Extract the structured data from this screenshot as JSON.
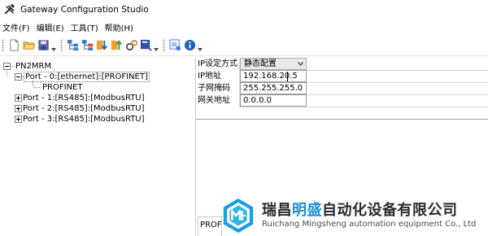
{
  "window": {
    "title": "Gateway Configuration Studio",
    "app_icon": "tools-icon"
  },
  "menu": {
    "items": [
      {
        "label": "文件(F)"
      },
      {
        "label": "编辑(E)"
      },
      {
        "label": "工具(T)"
      },
      {
        "label": "帮助(H)"
      }
    ]
  },
  "toolbar": {
    "buttons": [
      {
        "icon": "new-file-icon"
      },
      {
        "icon": "open-folder-icon"
      },
      {
        "icon": "save-icon"
      },
      {
        "icon": "add-node-icon"
      },
      {
        "icon": "delete-node-icon"
      },
      {
        "icon": "download-icon"
      },
      {
        "icon": "upload-icon"
      },
      {
        "icon": "settings-icon"
      },
      {
        "icon": "export-icon"
      },
      {
        "icon": "monitor-icon"
      },
      {
        "icon": "info-icon"
      }
    ]
  },
  "tree": {
    "root": "PN2MRM",
    "nodes": [
      {
        "label": "Port - 0:[ethernet]:[PROFINET]"
      },
      {
        "label": "PROFINET"
      },
      {
        "label": "Port - 1:[RS485]:[ModbusRTU]"
      },
      {
        "label": "Port - 2:[RS485]:[ModbusRTU]"
      },
      {
        "label": "Port - 3:[RS485]:[ModbusRTU]"
      }
    ]
  },
  "properties": {
    "ip_mode": {
      "label": "IP设定方式",
      "value": "静态配置"
    },
    "ip_address": {
      "label": "IP地址",
      "value": "192.168.20.5"
    },
    "subnet_mask": {
      "label": "子网掩码",
      "value": "255.255.255.0"
    },
    "gateway": {
      "label": "网关地址",
      "value": "0.0.0.0"
    }
  },
  "bottom_tab": {
    "label": "PROF"
  },
  "watermark": {
    "company_cn_prefix": "瑞昌",
    "company_cn_highlight": "明盛",
    "company_cn_suffix": "自动化设备有限公司",
    "company_en": "Ruichang Mingsheng automation equipment Co., Ltd",
    "highlight_color": "#1a8fd6"
  }
}
